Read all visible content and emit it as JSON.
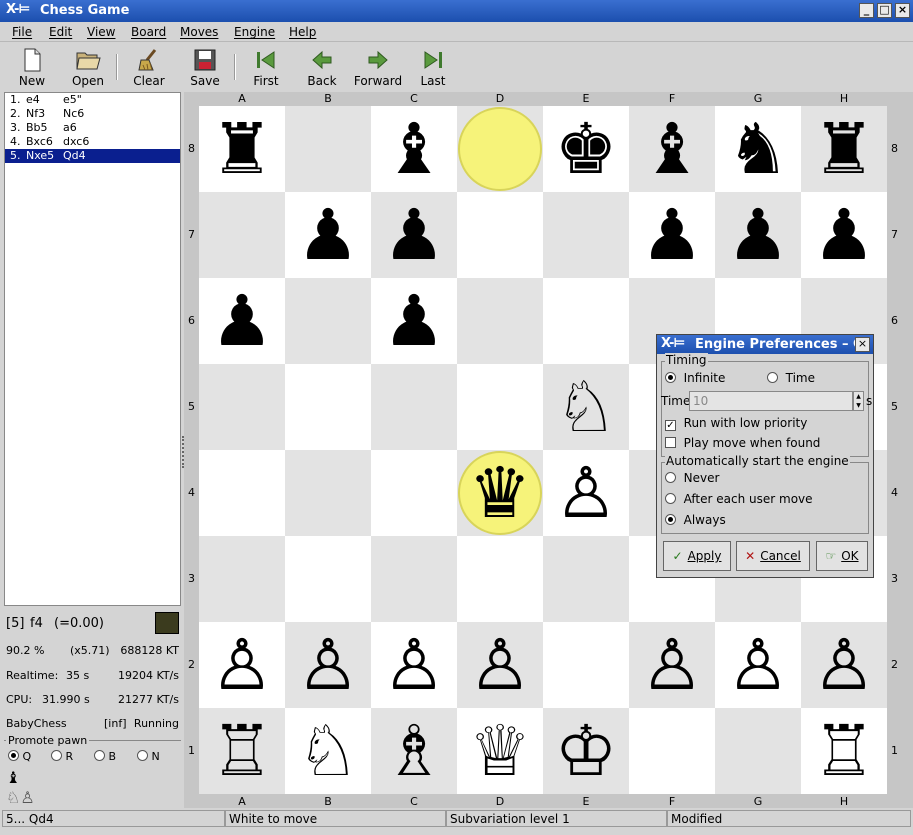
{
  "window": {
    "title": "Chess Game",
    "logo": "X-⊨",
    "buttons": [
      "_",
      "□",
      "×"
    ]
  },
  "menu": [
    "File",
    "Edit",
    "View",
    "Board",
    "Moves",
    "Engine",
    "Help"
  ],
  "toolbar": [
    {
      "label": "New",
      "icon": "new-document-icon"
    },
    {
      "label": "Open",
      "icon": "open-folder-icon"
    },
    {
      "label": "Clear",
      "icon": "broom-icon"
    },
    {
      "label": "Save",
      "icon": "floppy-disk-icon"
    },
    {
      "label": "First",
      "icon": "first-arrow-icon"
    },
    {
      "label": "Back",
      "icon": "back-arrow-icon"
    },
    {
      "label": "Forward",
      "icon": "forward-arrow-icon"
    },
    {
      "label": "Last",
      "icon": "last-arrow-icon"
    }
  ],
  "moves": [
    {
      "num": "1.",
      "white": "e4",
      "black": "e5\""
    },
    {
      "num": "2.",
      "white": "Nf3",
      "black": "Nc6"
    },
    {
      "num": "3.",
      "white": "Bb5",
      "black": "a6"
    },
    {
      "num": "4.",
      "white": "Bxc6",
      "black": "dxc6"
    },
    {
      "num": "5.",
      "white": "Nxe5",
      "black": "Qd4"
    }
  ],
  "selected_move_index": 4,
  "engine": {
    "depth": "[5]",
    "best": "f4",
    "eval": "(=0.00)",
    "percent": "90.2 %",
    "ratio": "(x5.71)",
    "nodes": "688128 KT",
    "realtime_label": "Realtime:",
    "realtime": "35 s",
    "realtime_speed": "19204 KT/s",
    "cpu_label": "CPU:",
    "cpu": "31.990 s",
    "cpu_speed": "21277 KT/s",
    "name": "BabyChess",
    "mode": "[inf]",
    "state": "Running",
    "swatch_color": "#3b3b1e"
  },
  "promote": {
    "title": "Promote pawn",
    "options": [
      "Q",
      "R",
      "B",
      "N"
    ],
    "selected": "Q"
  },
  "board": {
    "files": [
      "A",
      "B",
      "C",
      "D",
      "E",
      "F",
      "G",
      "H"
    ],
    "ranks": [
      "8",
      "7",
      "6",
      "5",
      "4",
      "3",
      "2",
      "1"
    ],
    "position": [
      "r.b.kbnr",
      ".pp..ppp",
      "p.p.....",
      "....N...",
      "...qP...",
      "........",
      "PPPP.PPP",
      "RNBQK..R"
    ],
    "highlighted_squares": [
      "d8",
      "d4"
    ],
    "light_color": "#ffffff",
    "dark_color": "#e3e3e3",
    "highlight_color": "#f6f37a"
  },
  "dialog": {
    "title": "Engine Preferences – C",
    "timing_label": "Timing",
    "infinite_label": "Infinite",
    "time_radio_label": "Time",
    "time_field_label": "Time:",
    "time_value": "10",
    "time_unit": "s",
    "low_priority_label": "Run with low priority",
    "low_priority_checked": true,
    "play_when_found_label": "Play move when found",
    "play_when_found_checked": false,
    "autostart_label": "Automatically start the engine",
    "never_label": "Never",
    "after_move_label": "After each user move",
    "always_label": "Always",
    "selected_timing": "Infinite",
    "selected_autostart": "Always",
    "apply_label": "Apply",
    "cancel_label": "Cancel",
    "ok_label": "OK"
  },
  "status": {
    "move": "5... Qd4",
    "turn": "White to move",
    "variation": "Subvariation level 1",
    "modified": "Modified"
  }
}
